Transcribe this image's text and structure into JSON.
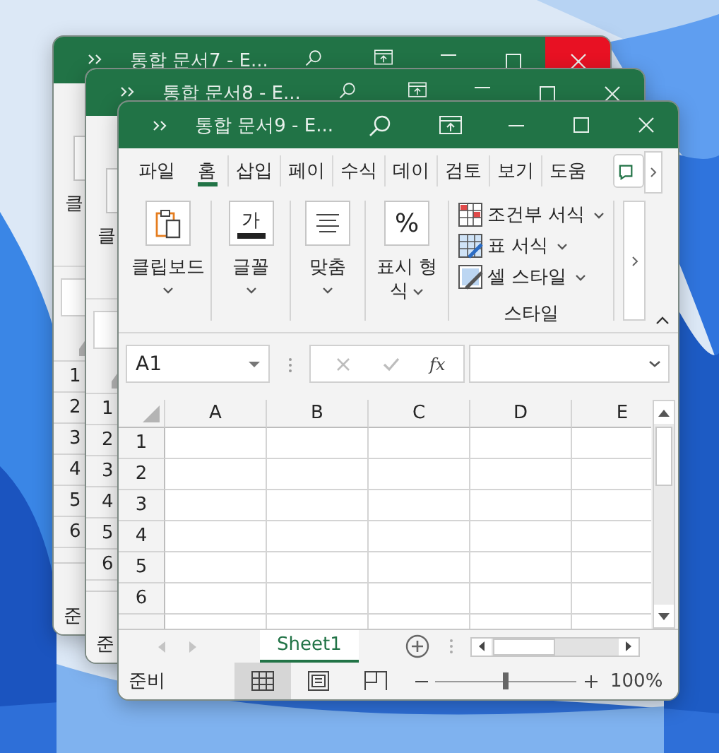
{
  "windows": [
    {
      "kind": "background",
      "title": "통합 문서7  -  E...",
      "close_highlighted": true,
      "strip": {
        "ribbon_label": "클",
        "rows": [
          "1",
          "2",
          "3",
          "4",
          "5",
          "6"
        ],
        "status": "준"
      }
    },
    {
      "kind": "background",
      "title": "통합 문서8  -  E...",
      "close_highlighted": false,
      "strip": {
        "ribbon_label": "클",
        "rows": [
          "1",
          "2",
          "3",
          "4",
          "5",
          "6"
        ],
        "status": "준"
      }
    },
    {
      "kind": "main",
      "title": "통합 문서9  -  E...",
      "close_highlighted": false,
      "tabs": [
        {
          "label": "파일",
          "selected": false
        },
        {
          "label": "홈",
          "selected": true
        },
        {
          "label": "삽입",
          "selected": false
        },
        {
          "label": "페이",
          "selected": false
        },
        {
          "label": "수식",
          "selected": false
        },
        {
          "label": "데이",
          "selected": false
        },
        {
          "label": "검토",
          "selected": false
        },
        {
          "label": "보기",
          "selected": false
        },
        {
          "label": "도움",
          "selected": false
        }
      ],
      "groups": [
        {
          "kind": "clipboard",
          "label": "클립보드"
        },
        {
          "kind": "font",
          "label": "글꼴",
          "glyph": "가"
        },
        {
          "kind": "align",
          "label": "맞춤"
        },
        {
          "kind": "number",
          "label": "표시 형식",
          "glyph": "%"
        }
      ],
      "style_group": {
        "label": "스타일",
        "commands": [
          {
            "kind": "conditional",
            "label": "조건부 서식"
          },
          {
            "kind": "table",
            "label": "표 서식"
          },
          {
            "kind": "cell",
            "label": "셀 스타일"
          }
        ]
      },
      "formula_bar": {
        "name_box": "A1",
        "function_label": "fx"
      },
      "columns": [
        "A",
        "B",
        "C",
        "D",
        "E"
      ],
      "rows": [
        "1",
        "2",
        "3",
        "4",
        "5",
        "6"
      ],
      "sheets": [
        {
          "label": "Sheet1",
          "selected": true
        }
      ],
      "status": {
        "text": "준비",
        "views": [
          {
            "kind": "normal",
            "selected": true
          },
          {
            "kind": "page_layout",
            "selected": false
          },
          {
            "kind": "page_break",
            "selected": false
          }
        ],
        "zoom": {
          "level": 0.5,
          "reading": "100%"
        }
      }
    }
  ]
}
